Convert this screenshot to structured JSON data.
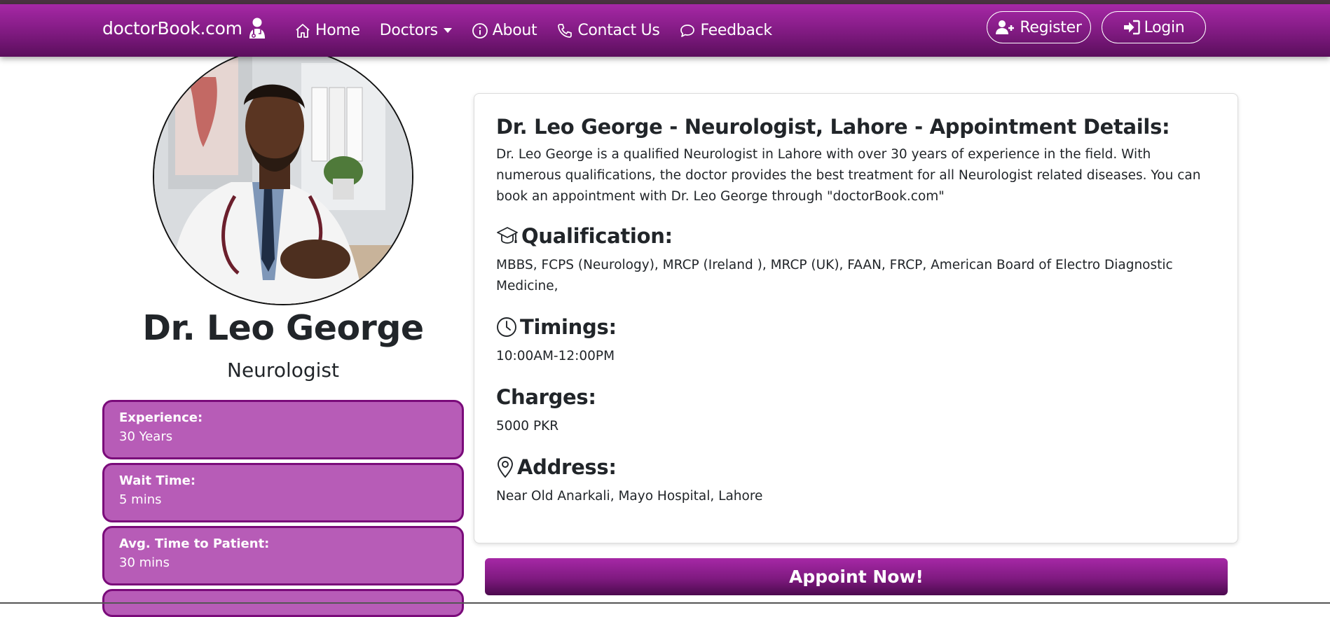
{
  "nav": {
    "brand": "doctorBook.com",
    "links": [
      {
        "label": "Home",
        "icon": "house-icon"
      },
      {
        "label": "Doctors",
        "icon": "dropdown-caret"
      },
      {
        "label": "About",
        "icon": "info-icon"
      },
      {
        "label": "Contact Us",
        "icon": "phone-icon"
      },
      {
        "label": "Feedback",
        "icon": "chat-icon"
      }
    ],
    "register_label": "Register",
    "login_label": "Login"
  },
  "doctor": {
    "name": "Dr. Leo George",
    "specialty": "Neurologist",
    "stats": [
      {
        "label": "Experience:",
        "value": "30 Years"
      },
      {
        "label": "Wait Time:",
        "value": "5 mins"
      },
      {
        "label": "Avg. Time to Patient:",
        "value": "30 mins"
      }
    ]
  },
  "details": {
    "heading": "Dr. Leo George - Neurologist, Lahore - Appointment Details:",
    "intro": "Dr. Leo George is a qualified Neurologist in Lahore with over 30 years of experience in the field. With numerous qualifications, the doctor provides the best treatment for all Neurologist related diseases. You can book an appointment with Dr. Leo George through \"doctorBook.com\"",
    "qualification_title": "Qualification:",
    "qualification_text": "MBBS, FCPS (Neurology), MRCP (Ireland ), MRCP (UK), FAAN, FRCP, American Board of Electro Diagnostic Medicine,",
    "timings_title": "Timings:",
    "timings_text": "10:00AM-12:00PM",
    "charges_title": "Charges:",
    "charges_text": "5000 PKR",
    "address_title": "Address:",
    "address_text": "Near Old Anarkali, Mayo Hospital, Lahore"
  },
  "appoint_label": "Appoint Now!",
  "colors": {
    "primary": "#7f1a80",
    "stat_bg": "#b75cb7",
    "stat_border": "#7a0b7a"
  }
}
